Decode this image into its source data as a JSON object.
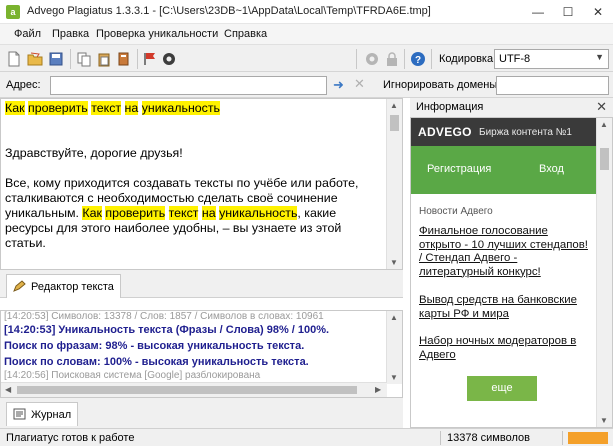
{
  "window": {
    "title": "Advego Plagiatus 1.3.3.1 - [C:\\Users\\23DB~1\\AppData\\Local\\Temp\\TFRDA6E.tmp]",
    "minimize": "—",
    "maximize": "☐",
    "close": "✕"
  },
  "menu": [
    "Файл",
    "Правка",
    "Проверка уникальности",
    "Справка"
  ],
  "toolbar": {
    "icons": [
      "new-document-icon",
      "open-folder-icon",
      "save-icon",
      "copy-icon",
      "paste-icon",
      "cut-icon",
      "check-flag-icon",
      "settings-icon",
      "gear-icon",
      "lock-icon",
      "help-icon"
    ],
    "encoding_label": "Кодировка:",
    "encoding_value": "UTF-8"
  },
  "addressbar": {
    "label": "Адрес:",
    "value": "",
    "ignore_label": "Игнорировать домены:",
    "ignore_value": ""
  },
  "editor": {
    "title_parts": [
      {
        "text": "Как",
        "hl": true
      },
      {
        "text": " ",
        "hl": false
      },
      {
        "text": "проверить",
        "hl": true
      },
      {
        "text": " ",
        "hl": false
      },
      {
        "text": "текст",
        "hl": true
      },
      {
        "text": " ",
        "hl": false
      },
      {
        "text": "на",
        "hl": true
      },
      {
        "text": " ",
        "hl": false
      },
      {
        "text": "уникальность",
        "hl": true
      }
    ],
    "greeting": "Здравствуйте, дорогие друзья!",
    "paragraph_parts": [
      {
        "text": "Все, кому приходится создавать тексты по учёбе или работе, сталкиваются с необходимостью сделать своё сочинение уникальным. ",
        "hl": false
      },
      {
        "text": "Как",
        "hl": true
      },
      {
        "text": " ",
        "hl": false
      },
      {
        "text": "проверить",
        "hl": true
      },
      {
        "text": " ",
        "hl": false
      },
      {
        "text": "текст",
        "hl": true
      },
      {
        "text": " ",
        "hl": false
      },
      {
        "text": "на",
        "hl": true
      },
      {
        "text": " ",
        "hl": false
      },
      {
        "text": "уникальность",
        "hl": true
      },
      {
        "text": ", какие ресурсы для этого наиболее удобны, – вы узнаете из этой статьи.",
        "hl": false
      }
    ],
    "tab_label": "Редактор текста",
    "highlight_color": "#fff200"
  },
  "log": {
    "lines": [
      {
        "text": "[14:20:53] Символов: 13378 / Слов: 1857 / Символов в словах: 10961",
        "style": "gray"
      },
      {
        "text": "[14:20:53] Уникальность текста (Фразы / Слова) 98% / 100%.",
        "style": "strong"
      },
      {
        "text": "Поиск по фразам: 98% - высокая уникальность текста.",
        "style": "strong"
      },
      {
        "text": "Поиск по словам: 100% - высокая уникальность текста.",
        "style": "strong"
      },
      {
        "text": "[14:20:56] Поисковая система [Google] разблокирована",
        "style": "gray"
      }
    ],
    "tab_label": "Журнал"
  },
  "info_panel": {
    "title": "Информация",
    "close": "✕",
    "brand": "ADVEGO",
    "tagline": "Биржа контента №1",
    "nav": [
      "Регистрация",
      "Вход"
    ],
    "news_title": "Новости Адвего",
    "news": [
      "Финальное голосование открыто - 10 лучших стендапов! / Стендап Адвего - литературный конкурс!",
      "Вывод средств на банковские карты РФ и мира",
      "Набор ночных модераторов в Адвего"
    ],
    "more_button": "еще",
    "brand_color": "#5aa846"
  },
  "status": {
    "left": "Плагиатус готов к работе",
    "chars": "13378 символов",
    "progress_color": "#f4a02a"
  }
}
